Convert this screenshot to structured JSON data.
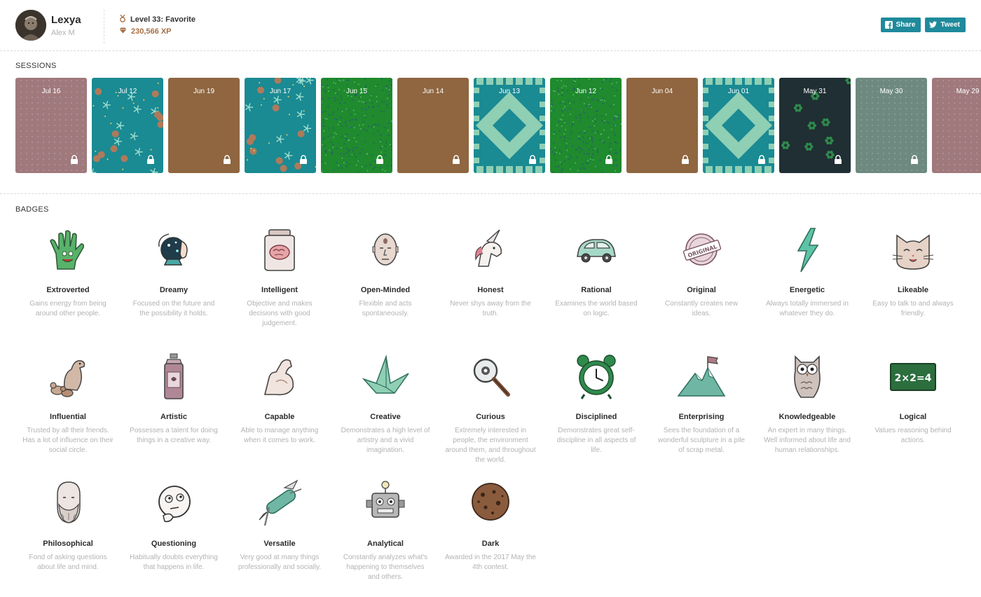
{
  "profile": {
    "name": "Lexya",
    "handle": "Alex M",
    "level": "Level 33: Favorite",
    "xp": "230,566 XP"
  },
  "share": {
    "share_label": "Share",
    "tweet_label": "Tweet"
  },
  "sessions_title": "SESSIONS",
  "sessions": [
    {
      "date": "Jul 16",
      "pattern": "dots",
      "color": "#a0797d"
    },
    {
      "date": "Jul 12",
      "pattern": "starfish",
      "color": "#1a8a93"
    },
    {
      "date": "Jun 19",
      "pattern": "plain",
      "color": "#8f6640"
    },
    {
      "date": "Jun 17",
      "pattern": "starfish",
      "color": "#1a8a93"
    },
    {
      "date": "Jun 15",
      "pattern": "speckle",
      "color": "#1f8a2e"
    },
    {
      "date": "Jun 14",
      "pattern": "plain",
      "color": "#8f6640"
    },
    {
      "date": "Jun 13",
      "pattern": "aztec",
      "color": "#1a8a93"
    },
    {
      "date": "Jun 12",
      "pattern": "speckle",
      "color": "#1f8a2e"
    },
    {
      "date": "Jun 04",
      "pattern": "plain",
      "color": "#8f6640"
    },
    {
      "date": "Jun 01",
      "pattern": "aztec",
      "color": "#1a8a93"
    },
    {
      "date": "May 31",
      "pattern": "leaves",
      "color": "#1f2f33"
    },
    {
      "date": "May 30",
      "pattern": "dots",
      "color": "#6e8a80"
    },
    {
      "date": "May 29",
      "pattern": "dots",
      "color": "#a0797d"
    }
  ],
  "badges_title": "BADGES",
  "badges": [
    {
      "name": "Extroverted",
      "desc": "Gains energy from being around other people.",
      "icon": "monster-hand-icon"
    },
    {
      "name": "Dreamy",
      "desc": "Focused on the future and the possibility it holds.",
      "icon": "crystal-ball-icon"
    },
    {
      "name": "Intelligent",
      "desc": "Objective and makes decisions with good judgement.",
      "icon": "brain-jar-icon"
    },
    {
      "name": "Open-Minded",
      "desc": "Flexible and acts spontaneously.",
      "icon": "third-eye-head-icon"
    },
    {
      "name": "Honest",
      "desc": "Never shys away from the truth.",
      "icon": "unicorn-icon"
    },
    {
      "name": "Rational",
      "desc": "Examines the world based on logic.",
      "icon": "smart-car-icon"
    },
    {
      "name": "Original",
      "desc": "Constantly creates new ideas.",
      "icon": "original-stamp-icon"
    },
    {
      "name": "Energetic",
      "desc": "Always totally immersed in whatever they do.",
      "icon": "lightning-bolt-icon"
    },
    {
      "name": "Likeable",
      "desc": "Easy to talk to and always friendly.",
      "icon": "cat-face-icon"
    },
    {
      "name": "Influential",
      "desc": "Trusted by all their friends. Has a lot of influence on their social circle.",
      "icon": "duck-family-icon"
    },
    {
      "name": "Artistic",
      "desc": "Possesses a talent for doing things in a creative way.",
      "icon": "spray-can-icon"
    },
    {
      "name": "Capable",
      "desc": "Able to manage anything when it comes to work.",
      "icon": "flexed-arm-icon"
    },
    {
      "name": "Creative",
      "desc": "Demonstrates a high level of artistry and a vivid imagination.",
      "icon": "paper-crane-icon"
    },
    {
      "name": "Curious",
      "desc": "Extremely interested in people, the environment around them, and throughout the world.",
      "icon": "magnifying-glass-icon"
    },
    {
      "name": "Disciplined",
      "desc": "Demonstrates great self-discipline in all aspects of life.",
      "icon": "alarm-clock-icon"
    },
    {
      "name": "Enterprising",
      "desc": "Sees the foundation of a wonderful sculpture in a pile of scrap metal.",
      "icon": "mountain-flag-icon"
    },
    {
      "name": "Knowledgeable",
      "desc": "An expert in many things. Well informed about life and human relationships.",
      "icon": "owl-icon"
    },
    {
      "name": "Logical",
      "desc": "Values reasoning behind actions.",
      "icon": "chalkboard-icon"
    },
    {
      "name": "Philosophical",
      "desc": "Fond of asking questions about life and mind.",
      "icon": "philosopher-bust-icon"
    },
    {
      "name": "Questioning",
      "desc": "Habitually doubts everything that happens in life.",
      "icon": "thinking-face-icon"
    },
    {
      "name": "Versatile",
      "desc": "Very good at many things professionally and socially.",
      "icon": "swiss-knife-icon"
    },
    {
      "name": "Analytical",
      "desc": "Constantly analyzes what's happening to themselves and others.",
      "icon": "robot-icon"
    },
    {
      "name": "Dark",
      "desc": "Awarded in the 2017 May the 4th contest.",
      "icon": "cookie-planet-icon"
    }
  ],
  "colors": {
    "accent": "#1f8a9b",
    "xp": "#a56f47",
    "muted": "#b3b3b3"
  }
}
